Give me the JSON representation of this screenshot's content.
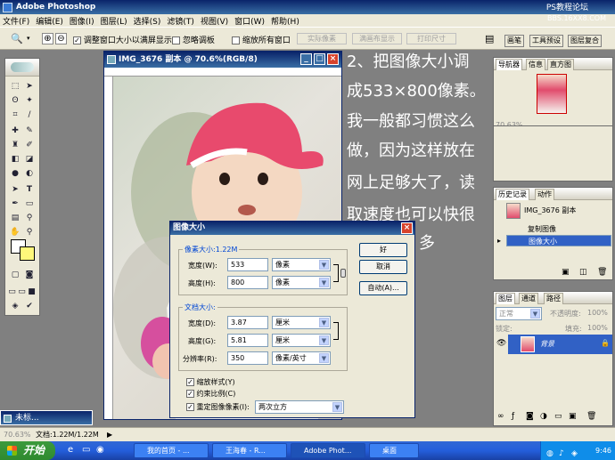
{
  "app": {
    "title": "Adobe Photoshop",
    "watermark_top": "PS教程论坛",
    "watermark_url": "BBS.16XX8.COM"
  },
  "menu": [
    "文件(F)",
    "编辑(E)",
    "图像(I)",
    "图层(L)",
    "选择(S)",
    "滤镜(T)",
    "视图(V)",
    "窗口(W)",
    "帮助(H)"
  ],
  "options_bar": {
    "resize_windows_label": "调整窗口大小以满屏显示",
    "resize_windows_checked": true,
    "ignore_palettes_label": "忽略调板",
    "ignore_palettes_checked": false,
    "zoom_all_label": "缩放所有窗口",
    "zoom_all_checked": false,
    "actual_pixels": "实际像素",
    "fit_screen": "满画布显示",
    "print_size": "打印尺寸",
    "palette_tabs": [
      "画笔",
      "工具预设",
      "图层复合"
    ]
  },
  "document": {
    "title": "IMG_3676 副本 @ 70.6%(RGB/8)"
  },
  "tutorial_lines": [
    "2、把图像大小调",
    "成533×800像素。",
    "我一般都习惯这么",
    "做，因为这样放在",
    "网上足够大了，读",
    "取速度也可以快很",
    "多"
  ],
  "dialog": {
    "title": "图像大小",
    "pixel_dims_legend": "像素大小:1.22M",
    "width_label": "宽度(W):",
    "width_value": "533",
    "width_unit": "像素",
    "height_label": "高度(H):",
    "height_value": "800",
    "height_unit": "像素",
    "doc_size_legend": "文档大小:",
    "doc_width_label": "宽度(D):",
    "doc_width_value": "3.87",
    "doc_width_unit": "厘米",
    "doc_height_label": "高度(G):",
    "doc_height_value": "5.81",
    "doc_height_unit": "厘米",
    "resolution_label": "分辨率(R):",
    "resolution_value": "350",
    "resolution_unit": "像素/英寸",
    "scale_styles_label": "缩放样式(Y)",
    "constrain_label": "约束比例(C)",
    "resample_label": "重定图像像素(I):",
    "resample_value": "两次立方",
    "ok": "好",
    "cancel": "取消",
    "auto": "自动(A)..."
  },
  "navigator": {
    "tabs": [
      "导航器",
      "信息",
      "直方图"
    ],
    "zoom": "70.63%"
  },
  "history": {
    "tabs": [
      "历史记录",
      "动作"
    ],
    "snapshot": "IMG_3676 副本",
    "items": [
      "复制图像",
      "图像大小"
    ],
    "selected_index": 1
  },
  "layers": {
    "tabs": [
      "图层",
      "通道",
      "路径"
    ],
    "blend_mode": "正常",
    "opacity_label": "不透明度:",
    "opacity_value": "100%",
    "lock_label": "锁定:",
    "fill_label": "填充:",
    "fill_value": "100%",
    "layer_name": "背景"
  },
  "minimized_doc": {
    "title": "未标..."
  },
  "status": {
    "zoom": "70.63%",
    "doc_info": "文档:1.22M/1.22M"
  },
  "taskbar": {
    "start": "开始",
    "tasks": [
      "我的首页 - ...",
      "王海春 - R...",
      "Adobe Phot...",
      "桌面"
    ],
    "active_index": 2,
    "clock": "9:46"
  }
}
